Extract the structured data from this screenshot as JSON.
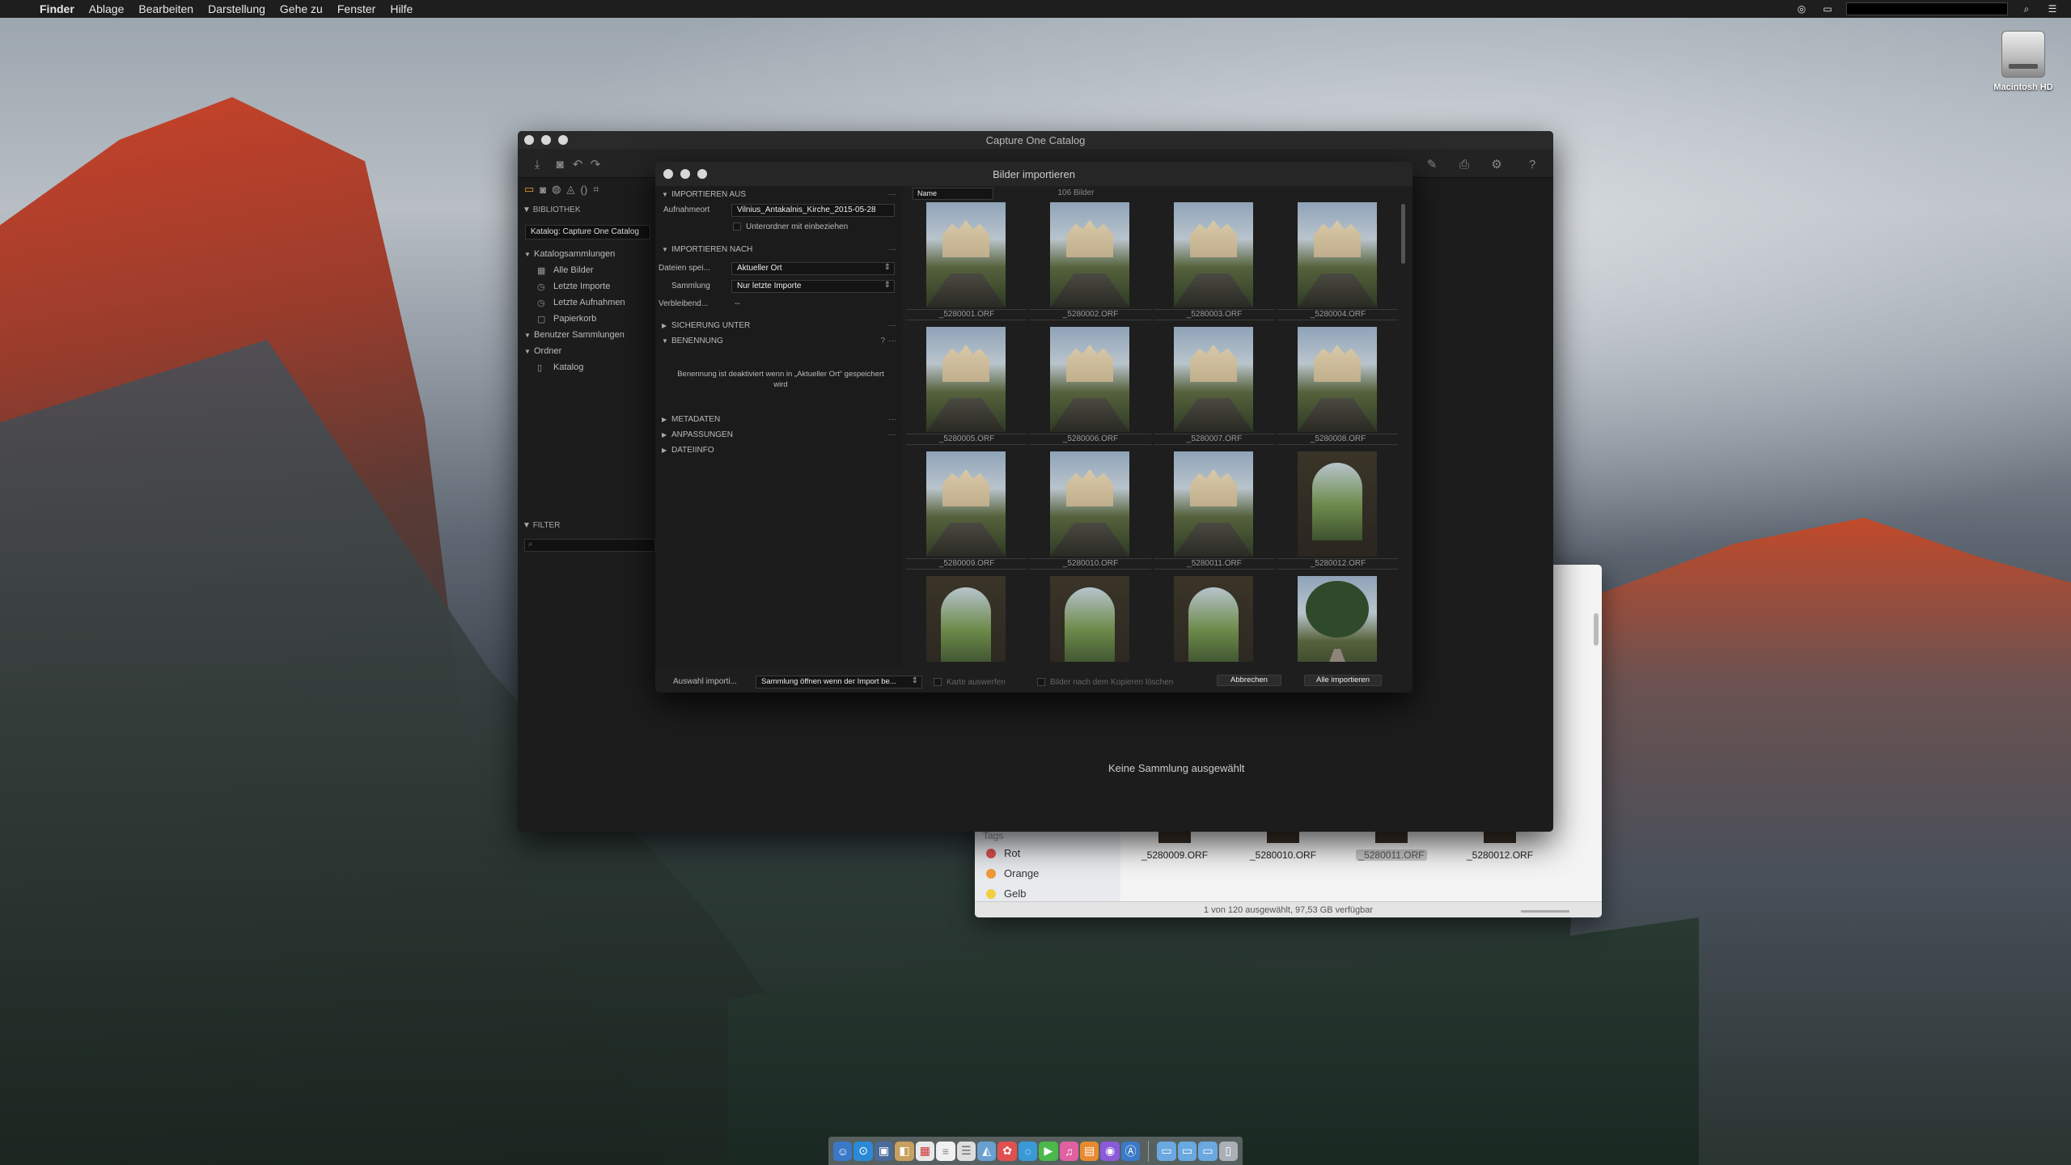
{
  "menubar": {
    "app": "Finder",
    "items": [
      "Ablage",
      "Bearbeiten",
      "Darstellung",
      "Gehe zu",
      "Fenster",
      "Hilfe"
    ]
  },
  "desktop": {
    "hd_label": "Macintosh HD"
  },
  "finder": {
    "tags_header": "Tags",
    "tags": [
      {
        "name": "Rot",
        "color": "#e05252"
      },
      {
        "name": "Orange",
        "color": "#f09a3a"
      },
      {
        "name": "Gelb",
        "color": "#f0d040"
      }
    ],
    "files": [
      "_5280009.ORF",
      "_5280010.ORF",
      "_5280011.ORF",
      "_5280012.ORF"
    ],
    "selected_file_index": 2,
    "status": "1 von 120 ausgewählt, 97,53 GB verfügbar"
  },
  "capture_one": {
    "title": "Capture One Catalog",
    "library_header": "BIBLIOTHEK",
    "catalog_field": "Katalog: Capture One Catalog",
    "tree": [
      {
        "label": "Katalogsammlungen",
        "level": 0,
        "tri": "▼",
        "icon": ""
      },
      {
        "label": "Alle Bilder",
        "level": 1,
        "tri": "",
        "icon": "▦"
      },
      {
        "label": "Letzte Importe",
        "level": 1,
        "tri": "",
        "icon": "◷"
      },
      {
        "label": "Letzte Aufnahmen",
        "level": 1,
        "tri": "",
        "icon": "◷"
      },
      {
        "label": "Papierkorb",
        "level": 1,
        "tri": "",
        "icon": "🗑"
      },
      {
        "label": "Benutzer Sammlungen",
        "level": 0,
        "tri": "▼",
        "icon": ""
      },
      {
        "label": "Ordner",
        "level": 0,
        "tri": "▼",
        "icon": ""
      },
      {
        "label": "Katalog",
        "level": 1,
        "tri": "",
        "icon": "📖"
      }
    ],
    "filter_header": "FILTER",
    "no_collection": "Keine Sammlung ausgewählt"
  },
  "dialog": {
    "title": "Bilder importieren",
    "sections": {
      "import_from": "IMPORTIEREN AUS",
      "import_to": "IMPORTIEREN NACH",
      "backup": "SICHERUNG UNTER",
      "naming": "BENENNUNG",
      "metadata": "METADATEN",
      "adjustments": "ANPASSUNGEN",
      "fileinfo": "DATEIINFO"
    },
    "fields": {
      "aufnahmeort_label": "Aufnahmeort",
      "aufnahmeort_value": "Vilnius_Antakalnis_Kirche_2015-05-28",
      "subfolders_label": "Unterordner mit einbeziehen",
      "save_label": "Dateien spei...",
      "save_value": "Aktueller Ort",
      "collection_label": "Sammlung",
      "collection_value": "Nur letzte Importe",
      "remaining_label": "Verbleibend...",
      "remaining_value": "--"
    },
    "naming_note": "Benennung ist deaktiviert wenn in „Aktueller Ort“ gespeichert wird",
    "sort_field": "Name",
    "image_count": "106 Bilder",
    "images": [
      {
        "name": "_5280001.ORF",
        "kind": "church"
      },
      {
        "name": "_5280002.ORF",
        "kind": "church"
      },
      {
        "name": "_5280003.ORF",
        "kind": "church"
      },
      {
        "name": "_5280004.ORF",
        "kind": "church"
      },
      {
        "name": "_5280005.ORF",
        "kind": "church"
      },
      {
        "name": "_5280006.ORF",
        "kind": "church"
      },
      {
        "name": "_5280007.ORF",
        "kind": "church"
      },
      {
        "name": "_5280008.ORF",
        "kind": "church"
      },
      {
        "name": "_5280009.ORF",
        "kind": "church"
      },
      {
        "name": "_5280010.ORF",
        "kind": "church"
      },
      {
        "name": "_5280011.ORF",
        "kind": "church"
      },
      {
        "name": "_5280012.ORF",
        "kind": "arch"
      },
      {
        "name": "",
        "kind": "arch"
      },
      {
        "name": "",
        "kind": "arch"
      },
      {
        "name": "",
        "kind": "arch"
      },
      {
        "name": "",
        "kind": "tree"
      }
    ],
    "footer": {
      "after_import_label": "Auswahl importi...",
      "after_import_value": "Sammlung öffnen wenn der Import be...",
      "eject_label": "Karte auswerfen",
      "delete_label": "Bilder nach dem Kopieren löschen",
      "cancel": "Abbrechen",
      "import_all": "Alle importieren"
    }
  }
}
